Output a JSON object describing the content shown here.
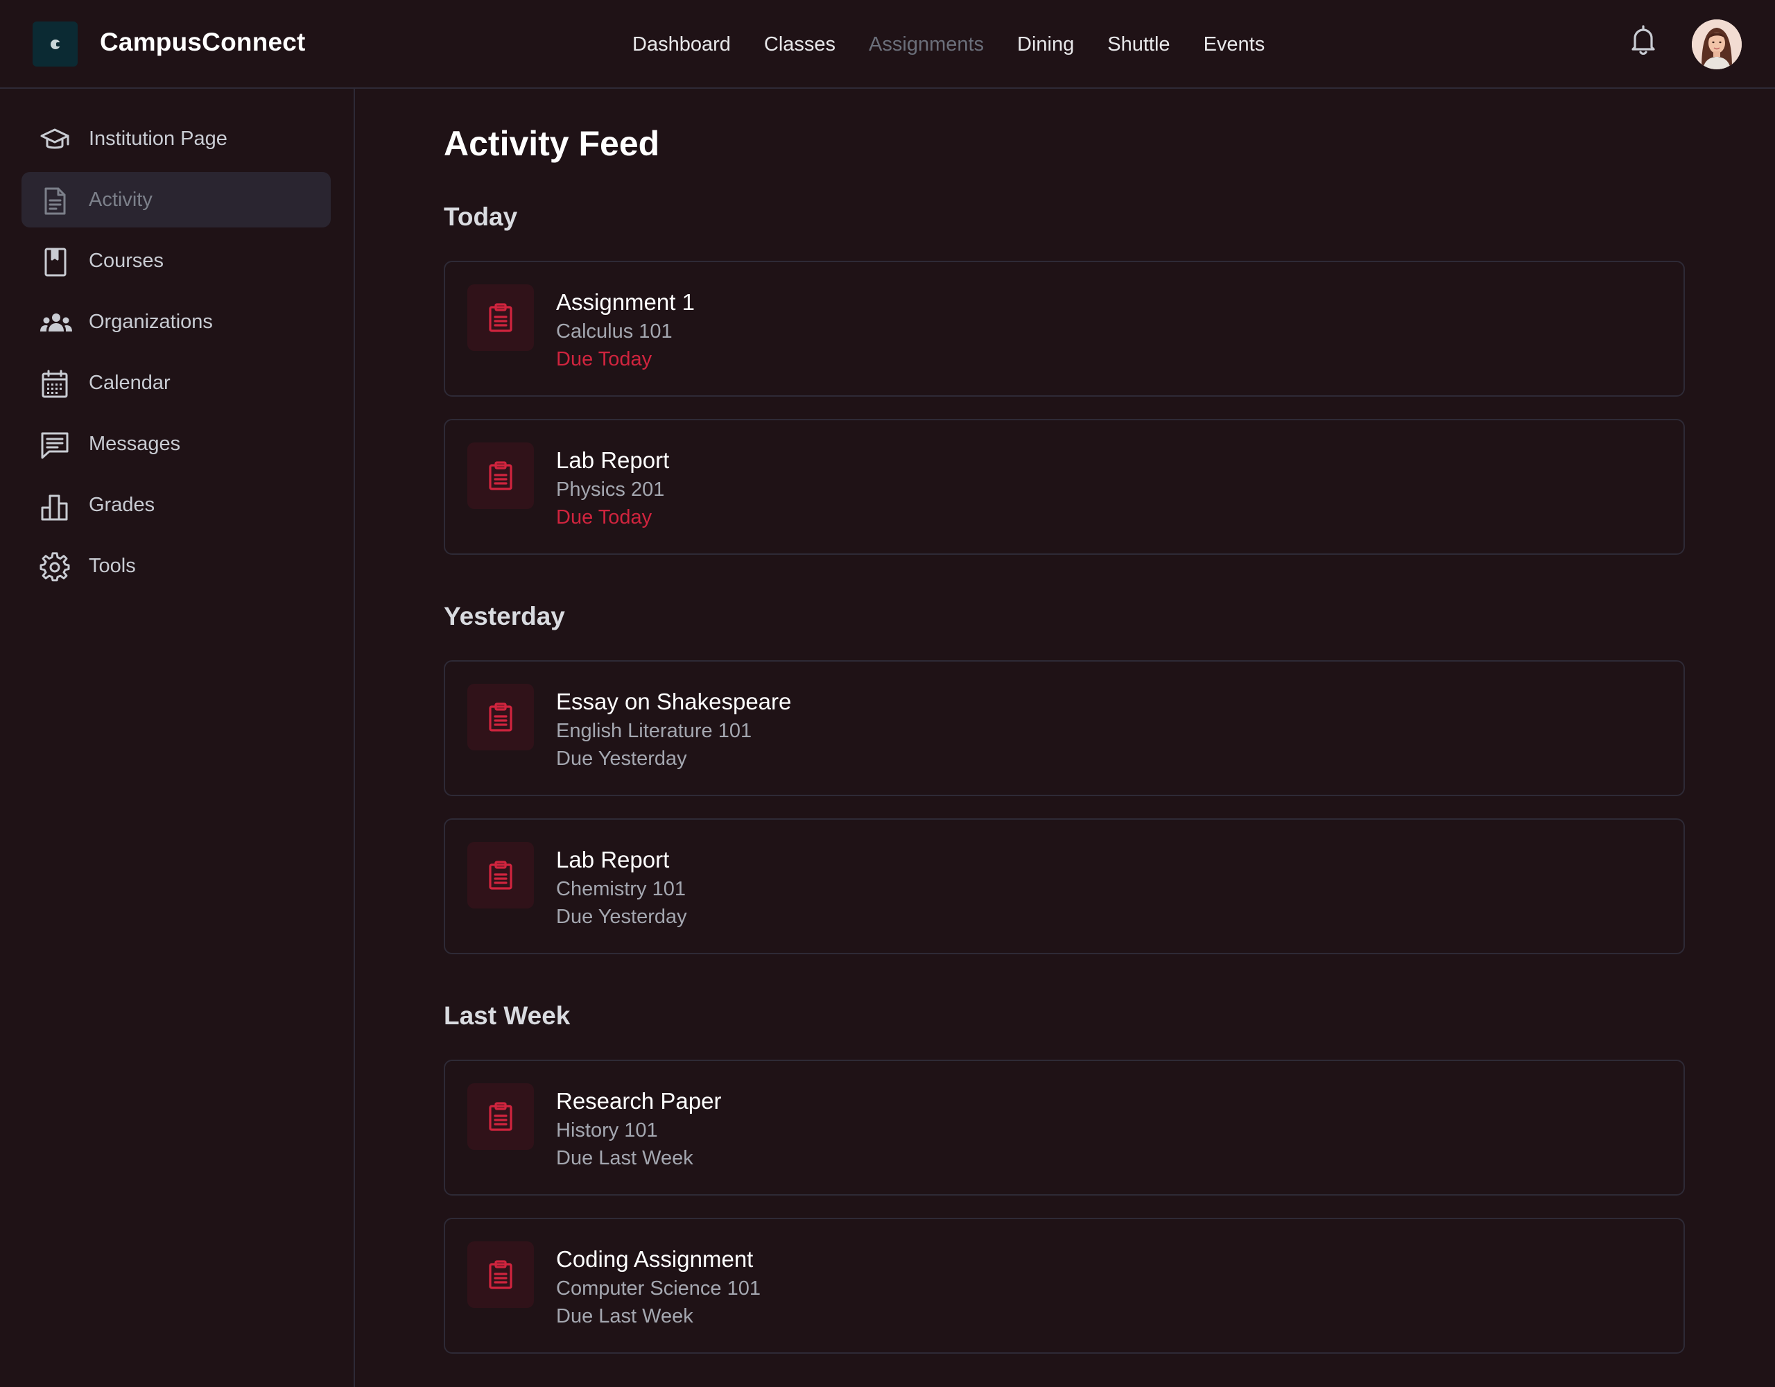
{
  "brand": {
    "name": "CampusConnect"
  },
  "nav": {
    "items": [
      {
        "label": "Dashboard"
      },
      {
        "label": "Classes"
      },
      {
        "label": "Assignments",
        "active": true
      },
      {
        "label": "Dining"
      },
      {
        "label": "Shuttle"
      },
      {
        "label": "Events"
      }
    ]
  },
  "header_icons": [
    "bell-icon",
    "avatar"
  ],
  "sidebar": {
    "items": [
      {
        "label": "Institution Page",
        "icon": "graduation-cap-icon"
      },
      {
        "label": "Activity",
        "icon": "document-icon",
        "active": true
      },
      {
        "label": "Courses",
        "icon": "bookmark-book-icon"
      },
      {
        "label": "Organizations",
        "icon": "people-group-icon"
      },
      {
        "label": "Calendar",
        "icon": "calendar-icon"
      },
      {
        "label": "Messages",
        "icon": "message-icon"
      },
      {
        "label": "Grades",
        "icon": "bar-chart-icon"
      },
      {
        "label": "Tools",
        "icon": "gear-icon"
      }
    ]
  },
  "main": {
    "title": "Activity Feed",
    "sections": [
      {
        "heading": "Today",
        "items": [
          {
            "title": "Assignment 1",
            "course": "Calculus 101",
            "due": "Due Today",
            "urgent": true
          },
          {
            "title": "Lab Report",
            "course": "Physics 201",
            "due": "Due Today",
            "urgent": true
          }
        ]
      },
      {
        "heading": "Yesterday",
        "items": [
          {
            "title": "Essay on Shakespeare",
            "course": "English Literature 101",
            "due": "Due Yesterday",
            "urgent": false
          },
          {
            "title": "Lab Report",
            "course": "Chemistry 101",
            "due": "Due Yesterday",
            "urgent": false
          }
        ]
      },
      {
        "heading": "Last Week",
        "items": [
          {
            "title": "Research Paper",
            "course": "History 101",
            "due": "Due Last Week",
            "urgent": false
          },
          {
            "title": "Coding Assignment",
            "course": "Computer Science 101",
            "due": "Due Last Week",
            "urgent": false
          }
        ]
      }
    ]
  },
  "colors": {
    "background": "#1f1216",
    "accent_red": "#d0243e",
    "icon_tile": "#301219",
    "border": "#2e2a36",
    "active_item": "#2a2530"
  }
}
